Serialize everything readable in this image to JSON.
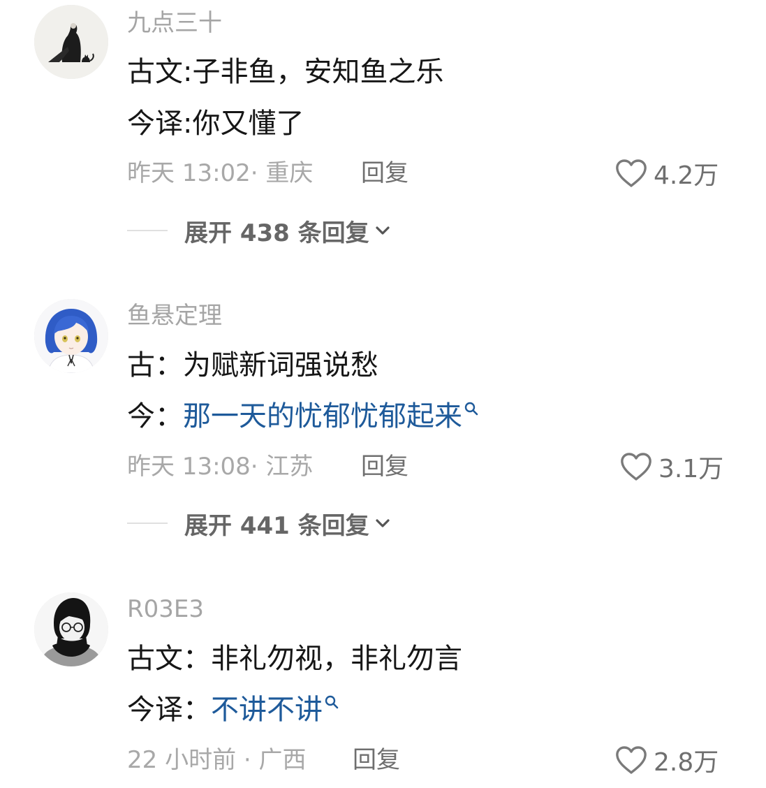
{
  "comments": [
    {
      "username": "九点三十",
      "lines": [
        {
          "prefix": "古文:子非鱼，安知鱼之乐",
          "link": ""
        },
        {
          "prefix": "今译:你又懂了",
          "link": ""
        }
      ],
      "meta": "昨天 13:02· 重庆",
      "reply": "回复",
      "likes": "4.2万",
      "expand": "展开 438 条回复"
    },
    {
      "username": "鱼悬定理",
      "lines": [
        {
          "prefix": "古：为赋新词强说愁",
          "link": ""
        },
        {
          "prefix": "今：",
          "link": "那一天的忧郁忧郁起来"
        }
      ],
      "meta": "昨天 13:08· 江苏",
      "reply": "回复",
      "likes": "3.1万",
      "expand": "展开 441 条回复"
    },
    {
      "username": "R03E3",
      "lines": [
        {
          "prefix": "古文：非礼勿视，非礼勿言",
          "link": ""
        },
        {
          "prefix": "今译：",
          "link": "不讲不讲"
        }
      ],
      "meta": "22 小时前 · 广西",
      "reply": "回复",
      "likes": "2.8万"
    }
  ],
  "colors": {
    "link": "#1e5a9a",
    "muted": "#a8a8a8",
    "text": "#161616"
  },
  "icons": {
    "like": "heart-outline-icon",
    "expand": "chevron-down-icon",
    "search": "search-icon"
  }
}
